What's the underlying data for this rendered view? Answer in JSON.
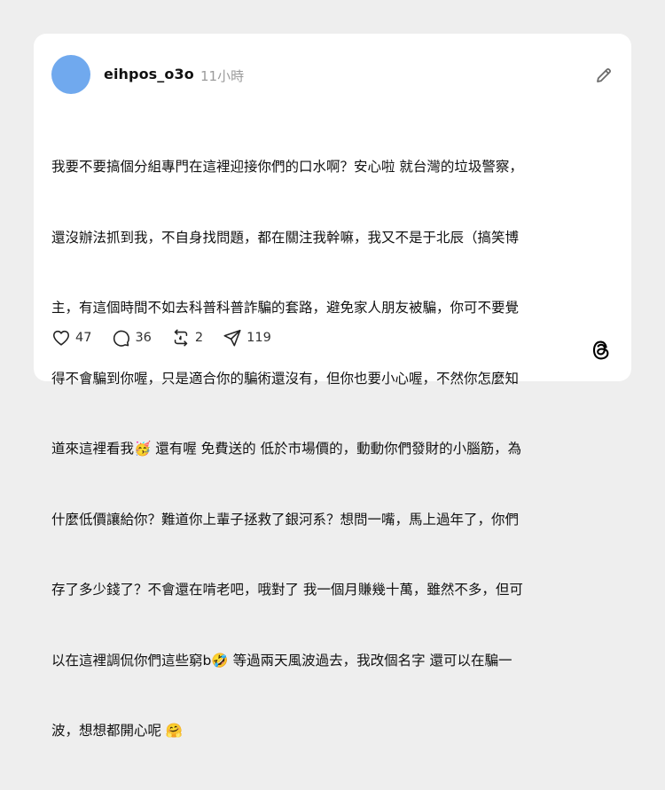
{
  "post": {
    "username": "eihpos_o3o",
    "timestamp": "11小時",
    "lines": [
      "我要不要搞個分組專門在這裡迎接你們的口水啊？安心啦 就台灣的垃圾警察，",
      "還沒辦法抓到我，不自身找問題，都在關注我幹嘛，我又不是于北辰（搞笑博",
      "主，有這個時間不如去科普科普詐騙的套路，避免家人朋友被騙，你可不要覺",
      "得不會騙到你喔，只是適合你的騙術還沒有，但你也要小心喔，不然你怎麼知",
      "道來這裡看我🥳 還有喔 免費送的 低於市場價的，動動你們發財的小腦筋，為",
      "什麼低價讓給你？難道你上輩子拯救了銀河系？想問一嘴，馬上過年了，你們",
      "存了多少錢了？不會還在啃老吧，哦對了 我一個月賺幾十萬，雖然不多，但可",
      "以在這裡調侃你們這些窮b🤣 等過兩天風波過去，我改個名字 還可以在騙一",
      "波，想想都開心呢 🤗"
    ]
  },
  "actions": {
    "likes": "47",
    "comments": "36",
    "reposts": "2",
    "shares": "119"
  },
  "icons": {
    "edit": "edit-pencil-icon",
    "like": "heart-icon",
    "comment": "comment-bubble-icon",
    "repost": "repost-arrows-icon",
    "share": "share-send-icon",
    "brand": "threads-logo-icon"
  },
  "colors": {
    "avatar": "#70a9ee",
    "background": "#eeeeee",
    "card": "#ffffff",
    "muted_text": "#9b9b9b"
  }
}
